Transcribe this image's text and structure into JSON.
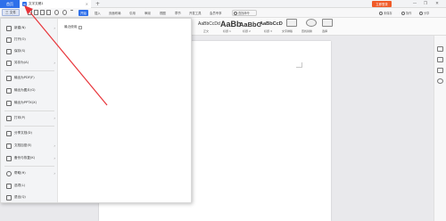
{
  "titlebar": {
    "home_tab": "首页",
    "doc_tab": "文字文稿1",
    "doc_badge": "W",
    "close_glyph": "×",
    "add_glyph": "+",
    "login_button": "立即登录",
    "min_glyph": "—",
    "max_glyph": "❐",
    "close_win_glyph": "✕"
  },
  "ribbon": {
    "file_menu": "三 文件",
    "tabs": [
      "开始",
      "插入",
      "页面布局",
      "引用",
      "审阅",
      "视图",
      "章节",
      "开发工具",
      "会员专享"
    ],
    "active_tab": "开始",
    "search": "查找命令",
    "right_links": [
      "未保存",
      "协作",
      "分享"
    ]
  },
  "styles": [
    {
      "preview": "AaBbCcDd",
      "caption": "正文"
    },
    {
      "preview": "AaBb",
      "caption": "标题 1"
    },
    {
      "preview": "AaBbC",
      "caption": "标题 2"
    },
    {
      "preview": "AaBbCcD",
      "caption": "标题 3"
    }
  ],
  "tools": [
    {
      "caption": "文字排版"
    },
    {
      "caption": "查找替换"
    },
    {
      "caption": "选择"
    }
  ],
  "file_menu": {
    "items": [
      {
        "label": "新建(N)",
        "has_arrow": true
      },
      {
        "label": "打开(O)",
        "has_arrow": false
      },
      {
        "label": "保存(S)",
        "has_arrow": false
      },
      {
        "label": "另存为(A)",
        "has_arrow": true
      },
      {
        "label": "输出为PDF(F)",
        "has_arrow": false
      },
      {
        "label": "输出为图片(G)",
        "has_arrow": false
      },
      {
        "label": "输出为PPTX(X)",
        "has_arrow": false
      },
      {
        "label": "打印(P)",
        "has_arrow": true
      },
      {
        "label": "分享文档(D)",
        "has_arrow": false
      },
      {
        "label": "文档加密(E)",
        "has_arrow": true
      },
      {
        "label": "备份与恢复(K)",
        "has_arrow": true
      },
      {
        "label": "帮助(H)",
        "has_arrow": true
      },
      {
        "label": "选项(L)",
        "has_arrow": false
      },
      {
        "label": "退出(Q)",
        "has_arrow": false
      }
    ],
    "recent_title": "最近使用"
  },
  "colors": {
    "accent": "#2e6fea",
    "login": "#f05a28",
    "annotation_arrow": "#e8343a"
  }
}
